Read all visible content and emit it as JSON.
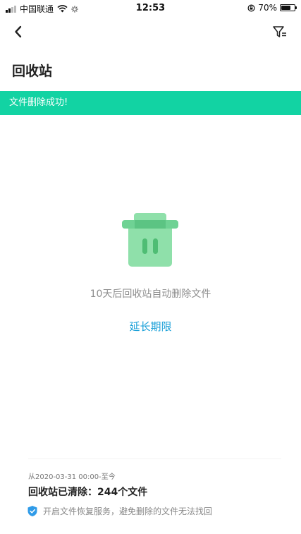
{
  "status_bar": {
    "carrier": "中国联通",
    "time": "12:53",
    "battery": "70%",
    "battery_level": 0.7
  },
  "nav": {
    "back_icon": "chevron-left-icon",
    "filter_icon": "filter-icon"
  },
  "page": {
    "title": "回收站"
  },
  "toast": {
    "message": "文件删除成功!",
    "color": "#12d3a3"
  },
  "empty_state": {
    "icon": "trash-icon",
    "info": "10天后回收站自动删除文件",
    "extend_label": "延长期限",
    "link_color": "#1aa0d8"
  },
  "footer": {
    "since": "从2020-03-31 00:00-至今",
    "cleared": "回收站已清除：244个文件",
    "recovery_icon": "shield-icon",
    "recovery_text": "开启文件恢复服务，避免删除的文件无法找回"
  }
}
